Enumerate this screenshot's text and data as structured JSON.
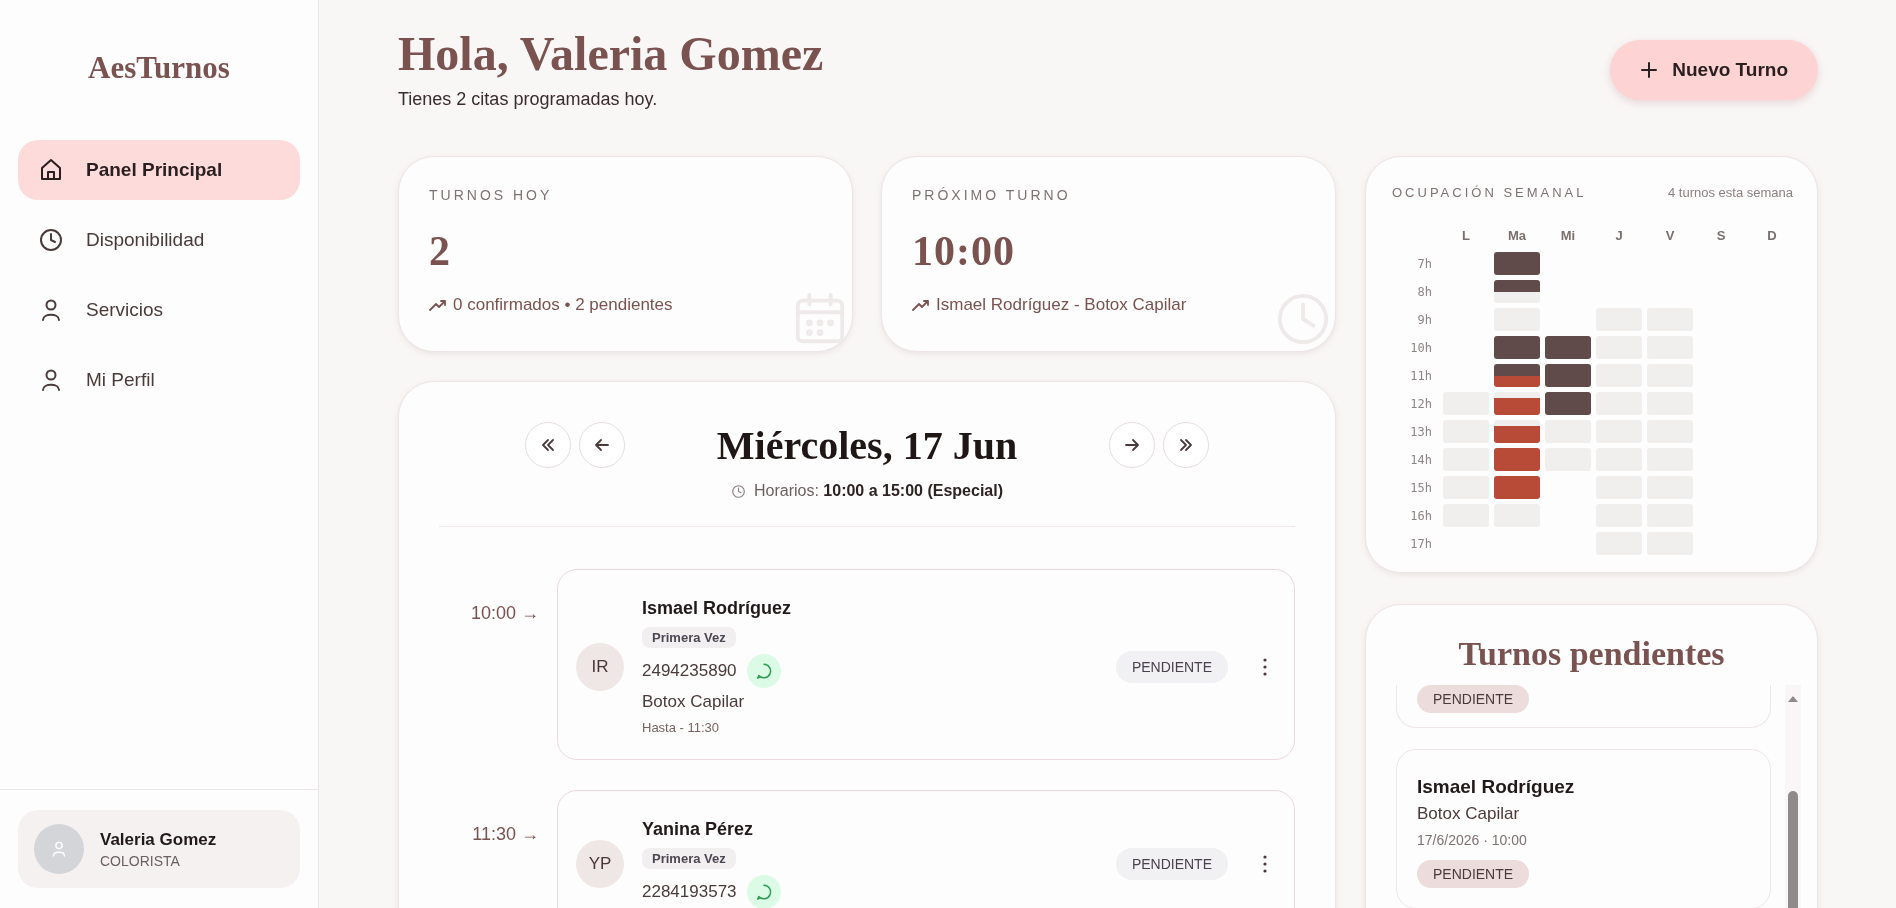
{
  "sidebar": {
    "logo": "AesTurnos",
    "items": [
      {
        "label": "Panel Principal",
        "selected": true
      },
      {
        "label": "Disponibilidad",
        "selected": false
      },
      {
        "label": "Servicios",
        "selected": false
      },
      {
        "label": "Mi Perfil",
        "selected": false
      }
    ],
    "user": {
      "name": "Valeria Gomez",
      "role": "COLORISTA"
    }
  },
  "header": {
    "title": "Hola, Valeria Gomez",
    "subtitle": "Tienes 2 citas programadas hoy.",
    "button": "Nuevo Turno"
  },
  "stats": [
    {
      "label": "TURNOS HOY",
      "value": "2",
      "detail": "0 confirmados • 2 pendientes"
    },
    {
      "label": "PRÓXIMO TURNO",
      "value": "10:00",
      "detail": "Ismael Rodríguez - Botox Capilar"
    }
  ],
  "agenda": {
    "date": "Miércoles, 17 Jun",
    "hours": "Horarios: **10:00 a 15:00 (Especial)**",
    "appointments": [
      {
        "time": "10:00 →",
        "initials": "IR",
        "name": "Ismael Rodríguez",
        "tag": "Primera Vez",
        "phone": "2494235890",
        "service": "Botox Capilar",
        "until": "Hasta - 11:30",
        "status": "PENDIENTE"
      },
      {
        "time": "11:30 →",
        "initials": "YP",
        "name": "Yanina Pérez",
        "tag": "Primera Vez",
        "phone": "2284193573",
        "status": "PENDIENTE"
      }
    ]
  },
  "weekly": {
    "title": "OCUPACIÓN SEMANAL",
    "summary": "4 turnos esta semana",
    "days": [
      "L",
      "Ma",
      "Mi",
      "J",
      "V",
      "S",
      "D"
    ],
    "rows": [
      {
        "label": "7h",
        "cells": [
          {
            "kind": "off"
          },
          {
            "kind": "busy"
          },
          {
            "kind": "off"
          },
          {
            "kind": "off"
          },
          {
            "kind": "off"
          },
          {
            "kind": "off"
          },
          {
            "kind": "off"
          }
        ]
      },
      {
        "label": "8h",
        "cells": [
          {
            "kind": "off"
          },
          {
            "kind": "busy-free"
          },
          {
            "kind": "off"
          },
          {
            "kind": "off"
          },
          {
            "kind": "off"
          },
          {
            "kind": "off"
          },
          {
            "kind": "off"
          }
        ]
      },
      {
        "label": "9h",
        "cells": [
          {
            "kind": "off"
          },
          {
            "kind": "free"
          },
          {
            "kind": "off"
          },
          {
            "kind": "free"
          },
          {
            "kind": "free"
          },
          {
            "kind": "off"
          },
          {
            "kind": "off"
          }
        ]
      },
      {
        "label": "10h",
        "cells": [
          {
            "kind": "off"
          },
          {
            "kind": "busy"
          },
          {
            "kind": "busy"
          },
          {
            "kind": "free"
          },
          {
            "kind": "free"
          },
          {
            "kind": "off"
          },
          {
            "kind": "off"
          }
        ]
      },
      {
        "label": "11h",
        "cells": [
          {
            "kind": "off"
          },
          {
            "kind": "busy-pending"
          },
          {
            "kind": "busy"
          },
          {
            "kind": "free"
          },
          {
            "kind": "free"
          },
          {
            "kind": "off"
          },
          {
            "kind": "off"
          }
        ]
      },
      {
        "label": "12h",
        "cells": [
          {
            "kind": "free"
          },
          {
            "kind": "free-pending"
          },
          {
            "kind": "busy"
          },
          {
            "kind": "free"
          },
          {
            "kind": "free"
          },
          {
            "kind": "off"
          },
          {
            "kind": "off"
          }
        ]
      },
      {
        "label": "13h",
        "cells": [
          {
            "kind": "free"
          },
          {
            "kind": "free-pending"
          },
          {
            "kind": "free"
          },
          {
            "kind": "free"
          },
          {
            "kind": "free"
          },
          {
            "kind": "off"
          },
          {
            "kind": "off"
          }
        ]
      },
      {
        "label": "14h",
        "cells": [
          {
            "kind": "free"
          },
          {
            "kind": "pending"
          },
          {
            "kind": "free"
          },
          {
            "kind": "free"
          },
          {
            "kind": "free"
          },
          {
            "kind": "off"
          },
          {
            "kind": "off"
          }
        ]
      },
      {
        "label": "15h",
        "cells": [
          {
            "kind": "free"
          },
          {
            "kind": "pending"
          },
          {
            "kind": "off"
          },
          {
            "kind": "free"
          },
          {
            "kind": "free"
          },
          {
            "kind": "off"
          },
          {
            "kind": "off"
          }
        ]
      },
      {
        "label": "16h",
        "cells": [
          {
            "kind": "free"
          },
          {
            "kind": "free"
          },
          {
            "kind": "off"
          },
          {
            "kind": "free"
          },
          {
            "kind": "free"
          },
          {
            "kind": "off"
          },
          {
            "kind": "off"
          }
        ]
      },
      {
        "label": "17h",
        "cells": [
          {
            "kind": "off"
          },
          {
            "kind": "off"
          },
          {
            "kind": "off"
          },
          {
            "kind": "free"
          },
          {
            "kind": "free"
          },
          {
            "kind": "off"
          },
          {
            "kind": "off"
          }
        ]
      }
    ]
  },
  "pending": {
    "title": "Turnos pendientes",
    "items": [
      {
        "status": "PENDIENTE"
      },
      {
        "name": "Ismael Rodríguez",
        "service": "Botox Capilar",
        "date": "17/6/2026 · 10:00",
        "status": "PENDIENTE"
      }
    ]
  }
}
